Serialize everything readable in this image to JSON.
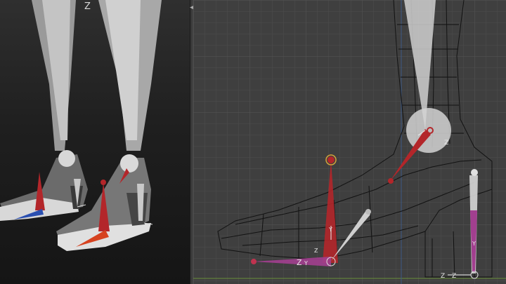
{
  "viewport_left": {
    "axis_indicator": "Z",
    "camera": "perspective"
  },
  "viewport_right": {
    "camera": "orthographic",
    "labels": {
      "ankle_z": "Z",
      "toe_z": "Z",
      "toe_y": "Y",
      "toe_bone_y": "Y",
      "toe_bone_z": "Z",
      "heel_z": "Z",
      "heel_z2": "Z",
      "heel_y": "Y"
    }
  },
  "icons": {
    "axis_gizmo": "axis-gizmo-icon",
    "split_handle": "split-resize-icon"
  },
  "colors": {
    "grid_bg": "#3f3f3f",
    "bone_red": "#b3262a",
    "bone_pink": "#a23f8f",
    "bone_grey": "#c9c9c9",
    "wire": "#111111"
  }
}
